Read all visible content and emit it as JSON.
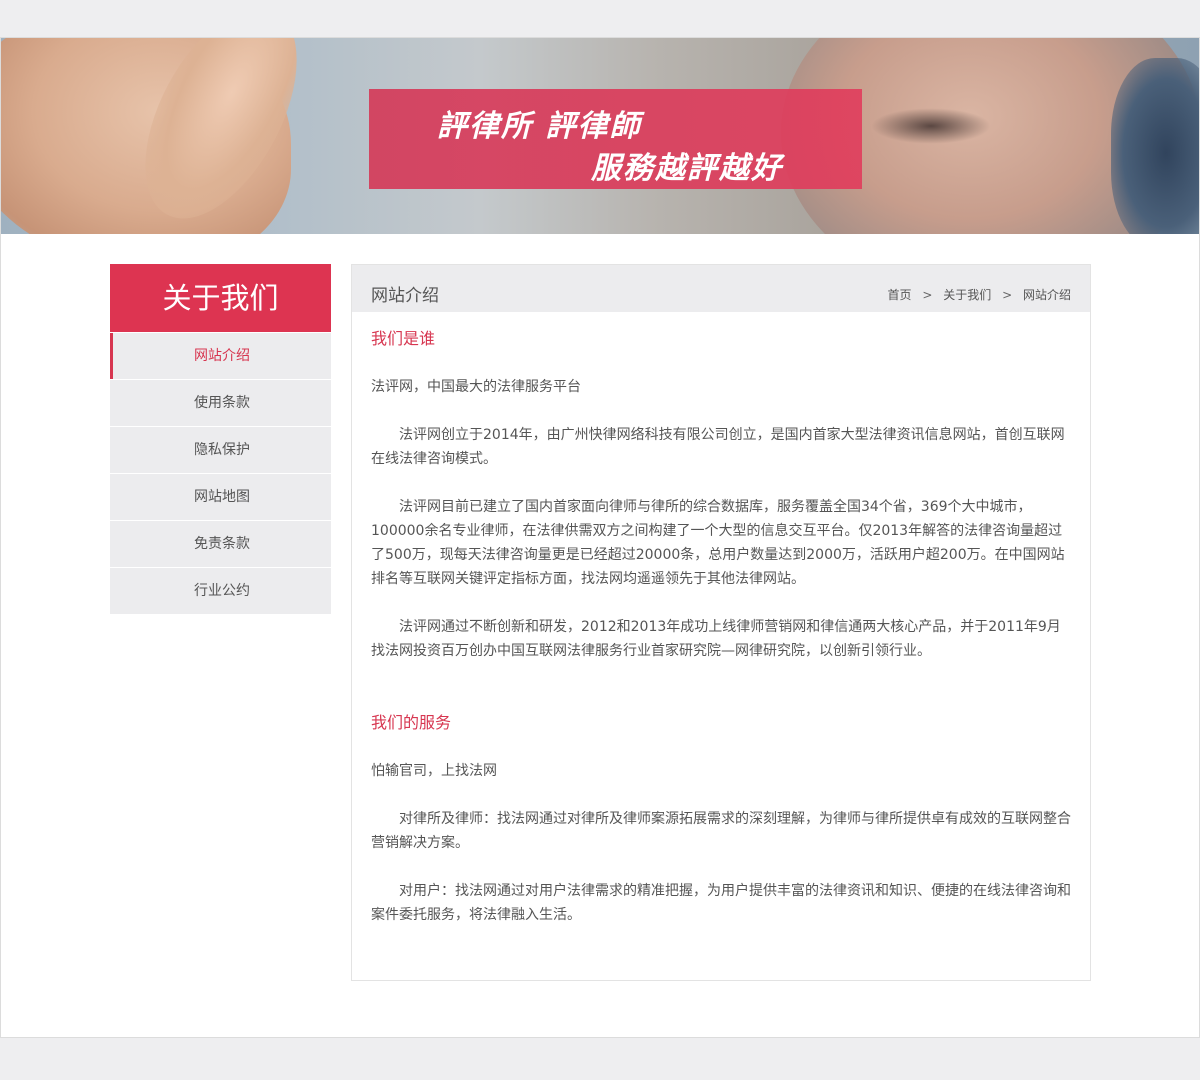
{
  "banner": {
    "slogan_line1": "評律所 評律師",
    "slogan_line2": "服務越評越好"
  },
  "sidebar": {
    "title": "关于我们",
    "items": [
      {
        "label": "网站介绍",
        "active": true
      },
      {
        "label": "使用条款"
      },
      {
        "label": "隐私保护"
      },
      {
        "label": "网站地图"
      },
      {
        "label": "免责条款"
      },
      {
        "label": "行业公约"
      }
    ]
  },
  "content": {
    "title": "网站介绍",
    "breadcrumb": {
      "home": "首页",
      "about": "关于我们",
      "current": "网站介绍",
      "separator": ">"
    },
    "section1": {
      "heading": "我们是谁",
      "lead": "法评网，中国最大的法律服务平台",
      "p1": "法评网创立于2014年，由广州快律网络科技有限公司创立，是国内首家大型法律资讯信息网站，首创互联网在线法律咨询模式。",
      "p2": "法评网目前已建立了国内首家面向律师与律所的综合数据库，服务覆盖全国34个省，369个大中城市，100000余名专业律师，在法律供需双方之间构建了一个大型的信息交互平台。仅2013年解答的法律咨询量超过了500万，现每天法律咨询量更是已经超过20000条，总用户数量达到2000万，活跃用户超200万。在中国网站排名等互联网关键评定指标方面，找法网均遥遥领先于其他法律网站。",
      "p3": "法评网通过不断创新和研发，2012和2013年成功上线律师营销网和律信通两大核心产品，并于2011年9月找法网投资百万创办中国互联网法律服务行业首家研究院—网律研究院，以创新引领行业。"
    },
    "section2": {
      "heading": "我们的服务",
      "lead": "怕输官司，上找法网",
      "p1": "对律所及律师：找法网通过对律所及律师案源拓展需求的深刻理解，为律师与律所提供卓有成效的互联网整合营销解决方案。",
      "p2": "对用户：找法网通过对用户法律需求的精准把握，为用户提供丰富的法律资讯和知识、便捷的在线法律咨询和案件委托服务，将法律融入生活。"
    }
  },
  "colors": {
    "accent": "#dd3451",
    "sidebar_bg": "#ececee",
    "page_bg": "#eeeef0"
  }
}
